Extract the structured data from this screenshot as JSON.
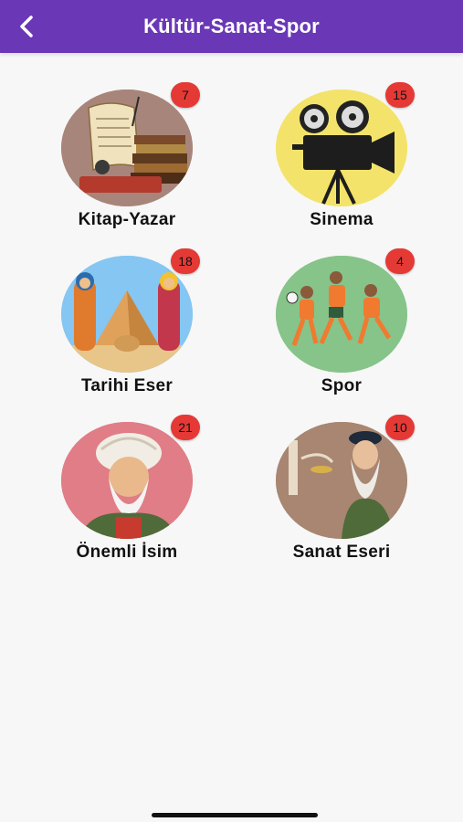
{
  "header": {
    "title": "Kültür-Sanat-Spor",
    "back_icon": "chevron-left-icon",
    "background": "#6a38b6"
  },
  "categories": [
    {
      "label": "Kitap-Yazar",
      "count": "7",
      "image": "books-scroll-image",
      "bg": "#a8857a"
    },
    {
      "label": "Sinema",
      "count": "15",
      "image": "film-camera-image",
      "bg": "#f3e36a"
    },
    {
      "label": "Tarihi Eser",
      "count": "18",
      "image": "pyramid-pharaoh-image",
      "bg": "#85c6f2"
    },
    {
      "label": "Spor",
      "count": "4",
      "image": "football-players-image",
      "bg": "#86c48a"
    },
    {
      "label": "Önemli İsim",
      "count": "21",
      "image": "ottoman-scholar-image",
      "bg": "#e07d86"
    },
    {
      "label": "Sanat Eseri",
      "count": "10",
      "image": "renaissance-artist-image",
      "bg": "#a88672"
    }
  ],
  "badge_color": "#e53935"
}
